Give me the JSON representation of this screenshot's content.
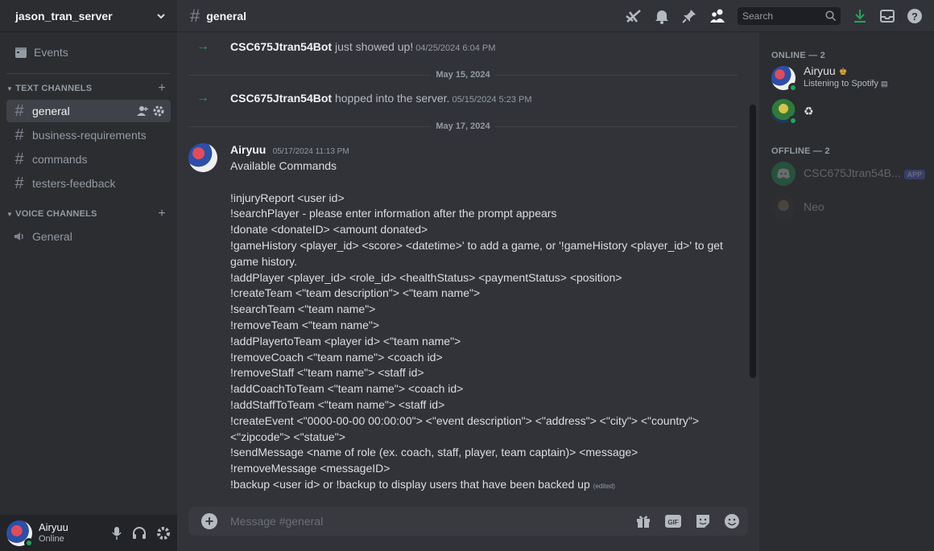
{
  "server": {
    "name": "jason_tran_server"
  },
  "events_label": "Events",
  "text_category": "TEXT CHANNELS",
  "voice_category": "VOICE CHANNELS",
  "text_channels": [
    "general",
    "business-requirements",
    "commands",
    "testers-feedback"
  ],
  "voice_channels": [
    "General"
  ],
  "user_panel": {
    "name": "Airyuu",
    "status": "Online"
  },
  "topbar": {
    "channel": "general",
    "search_placeholder": "Search"
  },
  "messages": {
    "sys1": {
      "author": "CSC675Jtran54Bot",
      "text": " just showed up!",
      "time": " 04/25/2024 6:04 PM"
    },
    "date1": "May 15, 2024",
    "sys2": {
      "author": "CSC675Jtran54Bot",
      "text": " hopped into the server.",
      "time": " 05/15/2024 5:23 PM"
    },
    "date2": "May 17, 2024",
    "main": {
      "author": "Airyuu",
      "time": "05/17/2024 11:13 PM",
      "lines": [
        "Available Commands",
        "",
        "!injuryReport <user id>",
        "!searchPlayer - please enter information after the prompt appears",
        "!donate <donateID> <amount donated>",
        "!gameHistory <player_id> <score> <datetime>' to add a game, or '!gameHistory <player_id>' to get",
        "game history.",
        "!addPlayer <player_id> <role_id> <healthStatus> <paymentStatus> <position>",
        "!createTeam <\"team description\"> <\"team name\">",
        "!searchTeam <\"team name\">",
        "!removeTeam <\"team name\">",
        "!addPlayertoTeam <player id> <\"team name\">",
        "!removeCoach <\"team name\"> <coach id>",
        "!removeStaff <\"team name\"> <staff id>",
        "!addCoachToTeam <\"team name\"> <coach id>",
        "!addStaffToTeam <\"team name\"> <staff id>",
        "!createEvent <\"0000-00-00 00:00:00\"> <\"event description\"> <\"address\"> <\"city\"> <\"country\">",
        "<\"zipcode\"> <\"statue\">",
        "!sendMessage <name of role (ex. coach, staff, player, team captain)> <message>",
        "!removeMessage <messageID>",
        "!backup <user id>   or !backup to display users that have been backed up"
      ],
      "edited": "(edited)"
    }
  },
  "composer": {
    "placeholder": "Message #general"
  },
  "members": {
    "online_header": "ONLINE — 2",
    "offline_header": "OFFLINE — 2",
    "online": [
      {
        "name": "Airyuu",
        "sub": "Listening to Spotify"
      },
      {
        "name": "♻",
        "sub": ""
      }
    ],
    "offline": [
      {
        "name": "CSC675Jtran54B...",
        "badge": "APP"
      },
      {
        "name": "Neo"
      }
    ]
  },
  "colors": {
    "online": "#23a55a",
    "accent": "#5865f2",
    "bot_arrow": "#23a55a"
  }
}
